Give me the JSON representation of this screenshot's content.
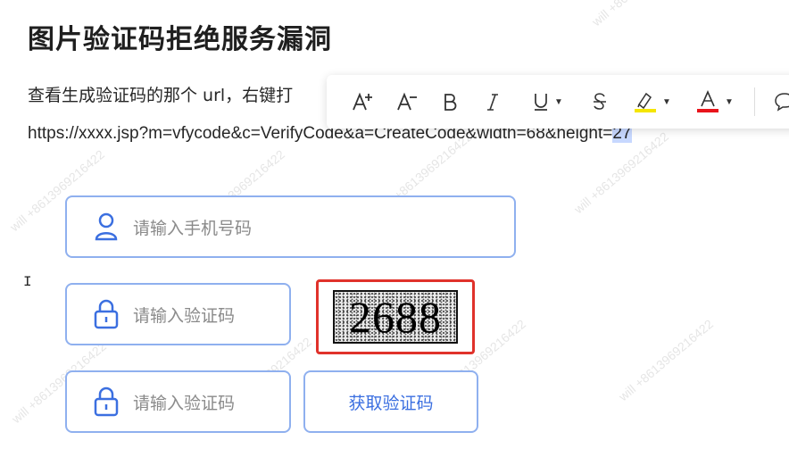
{
  "doc": {
    "title": "图片验证码拒绝服务漏洞",
    "para": "查看生成验证码的那个 url，右键打",
    "url_main": "https://xxxx.jsp?m=vfycode&c=VerifyCode&a=CreateCode&width=68&height=",
    "url_sel": "27"
  },
  "watermark": "will +8613969216422",
  "toolbar": {
    "items": [
      {
        "label": "A⁺",
        "icon": "font-size-increase-icon"
      },
      {
        "label": "A⁻",
        "icon": "font-size-decrease-icon"
      },
      {
        "label": "B",
        "icon": "bold-icon"
      },
      {
        "label": "I",
        "icon": "italic-icon"
      },
      {
        "label": "U",
        "icon": "underline-icon"
      },
      {
        "label": "S",
        "icon": "strikethrough-icon"
      },
      {
        "label": "",
        "icon": "highlight-icon",
        "color": "#f5e600"
      },
      {
        "label": "A",
        "icon": "font-color-icon",
        "color": "#e8141b"
      },
      {
        "label": "",
        "icon": "comment-icon"
      }
    ]
  },
  "form": {
    "phone_placeholder": "请输入手机号码",
    "code_placeholder": "请输入验证码",
    "code2_placeholder": "请输入验证码",
    "captcha_text": "2688",
    "get_code_label": "获取验证码"
  },
  "colors": {
    "accent": "#3b6fe0",
    "field_border": "#8fb0ef",
    "captcha_border": "#e0322b"
  }
}
